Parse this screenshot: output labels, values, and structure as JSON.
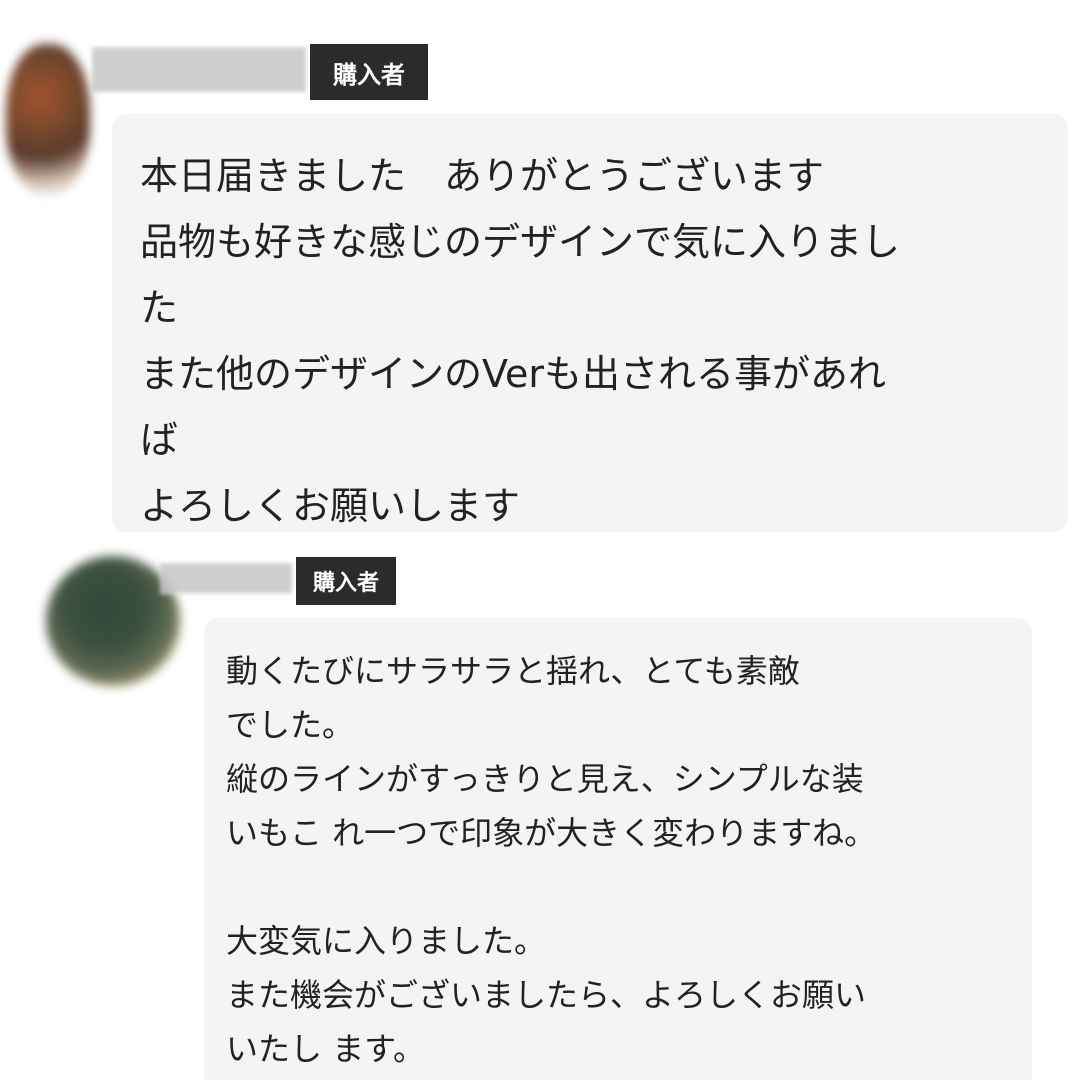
{
  "reviews": [
    {
      "badge": "購入者",
      "message": "本日届きました　ありがとうございます\n品物も好きな感じのデザインで気に入りまし\nた\nまた他のデザインのVerも出される事があれ\nば\nよろしくお願いします"
    },
    {
      "badge": "購入者",
      "message": "動くたびにサラサラと揺れ、とても素敵\nでした。\n縦のラインがすっきりと見え、シンプルな装\nいもこ れ一つで印象が大きく変わりますね。\n\n大変気に入りました。\nまた機会がございましたら、よろしくお願い\nいたし ます。"
    }
  ],
  "colors": {
    "badge_background": "#2b2b2b",
    "bubble_background": "#f4f4f4",
    "text": "#222222"
  }
}
